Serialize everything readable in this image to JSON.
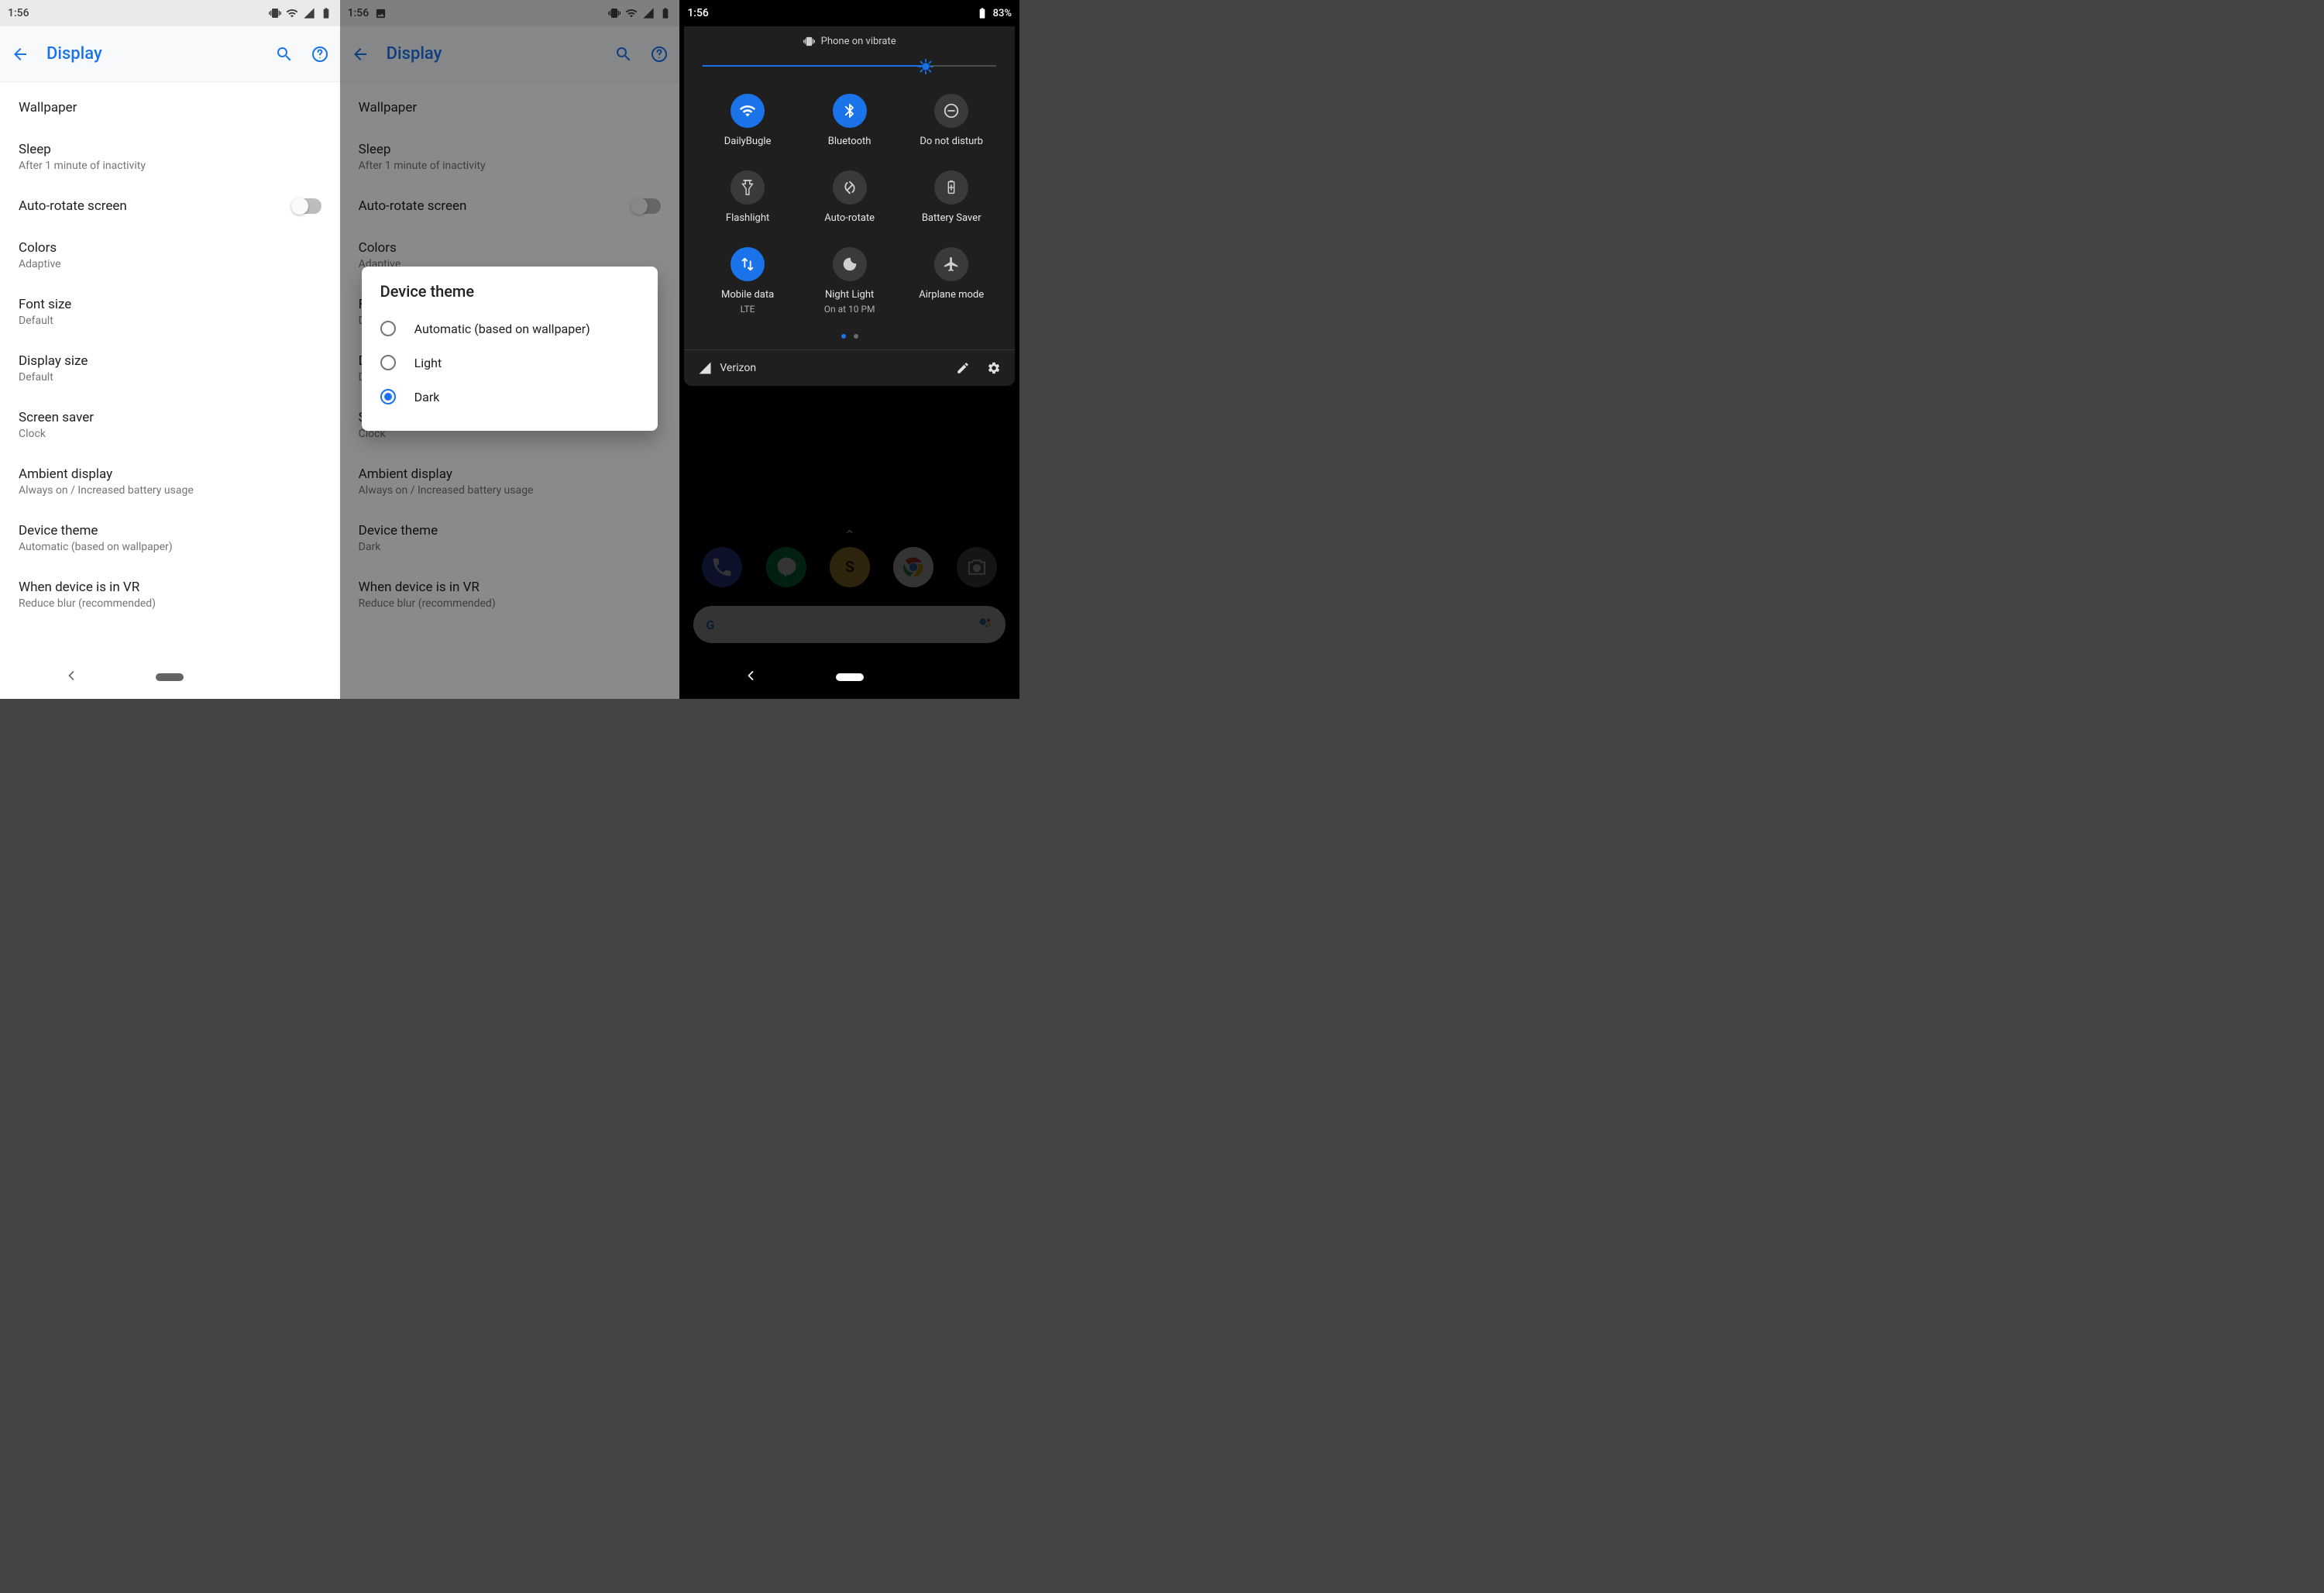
{
  "phone1": {
    "status": {
      "time": "1:56"
    },
    "appbar": {
      "title": "Display"
    },
    "items": [
      {
        "t": "Wallpaper",
        "s": ""
      },
      {
        "t": "Sleep",
        "s": "After 1 minute of inactivity"
      },
      {
        "t": "Auto-rotate screen",
        "s": "",
        "toggle": true
      },
      {
        "t": "Colors",
        "s": "Adaptive"
      },
      {
        "t": "Font size",
        "s": "Default"
      },
      {
        "t": "Display size",
        "s": "Default"
      },
      {
        "t": "Screen saver",
        "s": "Clock"
      },
      {
        "t": "Ambient display",
        "s": "Always on / Increased battery usage"
      },
      {
        "t": "Device theme",
        "s": "Automatic (based on wallpaper)"
      },
      {
        "t": "When device is in VR",
        "s": "Reduce blur (recommended)"
      }
    ]
  },
  "phone2": {
    "status": {
      "time": "1:56"
    },
    "appbar": {
      "title": "Display"
    },
    "items": [
      {
        "t": "Wallpaper",
        "s": ""
      },
      {
        "t": "Sleep",
        "s": "After 1 minute of inactivity"
      },
      {
        "t": "Auto-rotate screen",
        "s": "",
        "toggle": true
      },
      {
        "t": "Colors",
        "s": "Adaptive"
      },
      {
        "t": "Font size",
        "s": "Default"
      },
      {
        "t": "Display size",
        "s": "Default"
      },
      {
        "t": "Screen saver",
        "s": "Clock"
      },
      {
        "t": "Ambient display",
        "s": "Always on / Increased battery usage"
      },
      {
        "t": "Device theme",
        "s": "Dark"
      },
      {
        "t": "When device is in VR",
        "s": "Reduce blur (recommended)"
      }
    ],
    "dialog": {
      "title": "Device theme",
      "options": [
        {
          "label": "Automatic (based on wallpaper)",
          "selected": false
        },
        {
          "label": "Light",
          "selected": false
        },
        {
          "label": "Dark",
          "selected": true
        }
      ]
    }
  },
  "phone3": {
    "status": {
      "time": "1:56",
      "battery": "83%"
    },
    "qs": {
      "header": "Phone on vibrate",
      "brightness_pct": 76,
      "tiles": [
        {
          "icon": "wifi",
          "on": true,
          "label": "DailyBugle",
          "sub": ""
        },
        {
          "icon": "bt",
          "on": true,
          "label": "Bluetooth",
          "sub": ""
        },
        {
          "icon": "dnd",
          "on": false,
          "label": "Do not disturb",
          "sub": ""
        },
        {
          "icon": "flash",
          "on": false,
          "label": "Flashlight",
          "sub": ""
        },
        {
          "icon": "rotate",
          "on": false,
          "label": "Auto-rotate",
          "sub": ""
        },
        {
          "icon": "batt",
          "on": false,
          "label": "Battery Saver",
          "sub": ""
        },
        {
          "icon": "data",
          "on": true,
          "label": "Mobile data",
          "sub": "LTE"
        },
        {
          "icon": "moon",
          "on": false,
          "label": "Night Light",
          "sub": "On at 10 PM"
        },
        {
          "icon": "plane",
          "on": false,
          "label": "Airplane mode",
          "sub": ""
        }
      ],
      "carrier": "Verizon"
    },
    "apps": [
      {
        "name": "phone",
        "color": "#3c52c7"
      },
      {
        "name": "hangouts",
        "color": "#0f9d58"
      },
      {
        "name": "slack",
        "color": "#e8b44a"
      },
      {
        "name": "chrome",
        "color": "#ffffff"
      },
      {
        "name": "camera",
        "color": "#6a6a6a"
      }
    ]
  }
}
